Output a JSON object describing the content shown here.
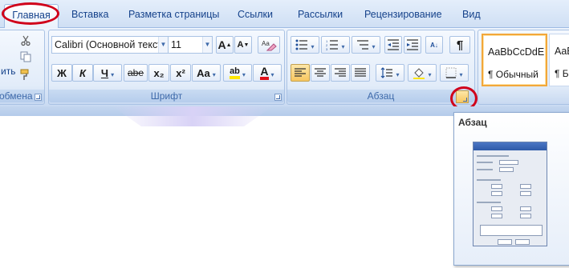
{
  "tabs": [
    {
      "label": "Главная",
      "active": true
    },
    {
      "label": "Вставка"
    },
    {
      "label": "Разметка страницы"
    },
    {
      "label": "Ссылки"
    },
    {
      "label": "Рассылки"
    },
    {
      "label": "Рецензирование"
    },
    {
      "label": "Вид"
    }
  ],
  "clipboard": {
    "paste_fragment": "ить",
    "label_fragment": "обмена"
  },
  "font": {
    "name": "Calibri (Основной текст",
    "size": "11",
    "group_label": "Шрифт",
    "bold": "Ж",
    "italic": "К",
    "underline": "Ч",
    "strike": "abe",
    "subscript": "x₂",
    "superscript": "x²",
    "case": "Aa",
    "grow": "A",
    "shrink": "A",
    "highlight": "ab",
    "font_color": "A"
  },
  "paragraph": {
    "group_label": "Абзац",
    "pilcrow": "¶",
    "sort": "A↓"
  },
  "styles": [
    {
      "sample": "AaBbCcDdE",
      "name": "¶ Обычный",
      "selected": true
    },
    {
      "sample": "AaBbC",
      "name": "¶ Бе"
    }
  ],
  "tooltip": {
    "title": "Абзац"
  },
  "colors": {
    "highlight": "#ffe600",
    "font_color": "#e0101a",
    "annotation": "#d0001a",
    "selected_style": "#f2a73a"
  }
}
